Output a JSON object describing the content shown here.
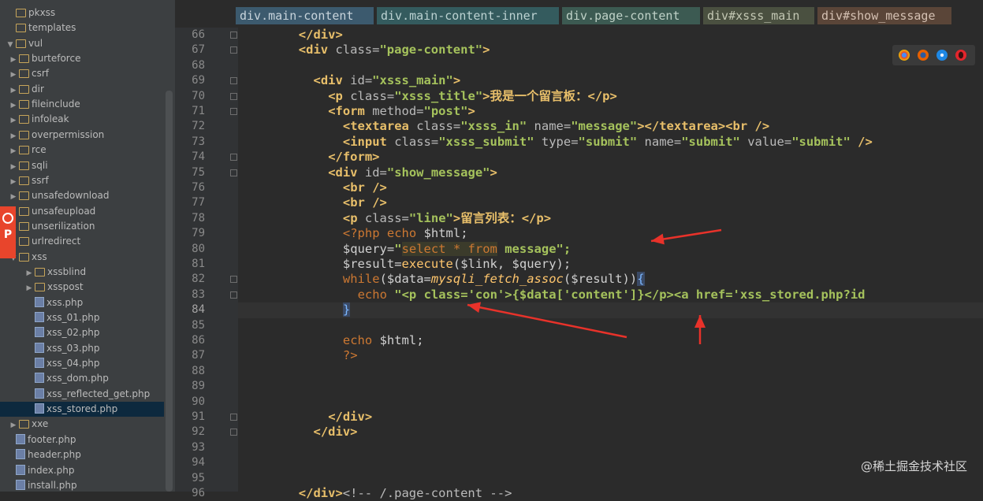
{
  "sidebar": {
    "items": [
      {
        "label": "pkxss",
        "kind": "folder",
        "indent": 0,
        "arrow": ""
      },
      {
        "label": "templates",
        "kind": "folder",
        "indent": 0,
        "arrow": ""
      },
      {
        "label": "vul",
        "kind": "folder",
        "indent": 0,
        "arrow": "▼"
      },
      {
        "label": "burteforce",
        "kind": "folder",
        "indent": 1,
        "arrow": "▶"
      },
      {
        "label": "csrf",
        "kind": "folder",
        "indent": 1,
        "arrow": "▶"
      },
      {
        "label": "dir",
        "kind": "folder",
        "indent": 1,
        "arrow": "▶"
      },
      {
        "label": "fileinclude",
        "kind": "folder",
        "indent": 1,
        "arrow": "▶"
      },
      {
        "label": "infoleak",
        "kind": "folder",
        "indent": 1,
        "arrow": "▶"
      },
      {
        "label": "overpermission",
        "kind": "folder",
        "indent": 1,
        "arrow": "▶"
      },
      {
        "label": "rce",
        "kind": "folder",
        "indent": 1,
        "arrow": "▶"
      },
      {
        "label": "sqli",
        "kind": "folder",
        "indent": 1,
        "arrow": "▶"
      },
      {
        "label": "ssrf",
        "kind": "folder",
        "indent": 1,
        "arrow": "▶"
      },
      {
        "label": "unsafedownload",
        "kind": "folder",
        "indent": 1,
        "arrow": "▶"
      },
      {
        "label": "unsafeupload",
        "kind": "folder",
        "indent": 1,
        "arrow": "▶"
      },
      {
        "label": "unserilization",
        "kind": "folder",
        "indent": 1,
        "arrow": "▶"
      },
      {
        "label": "urlredirect",
        "kind": "folder",
        "indent": 1,
        "arrow": "▶"
      },
      {
        "label": "xss",
        "kind": "folder",
        "indent": 1,
        "arrow": "▼"
      },
      {
        "label": "xssblind",
        "kind": "folder",
        "indent": 2,
        "arrow": "▶"
      },
      {
        "label": "xsspost",
        "kind": "folder",
        "indent": 2,
        "arrow": "▶"
      },
      {
        "label": "xss.php",
        "kind": "file",
        "indent": 2,
        "arrow": ""
      },
      {
        "label": "xss_01.php",
        "kind": "file",
        "indent": 2,
        "arrow": ""
      },
      {
        "label": "xss_02.php",
        "kind": "file",
        "indent": 2,
        "arrow": ""
      },
      {
        "label": "xss_03.php",
        "kind": "file",
        "indent": 2,
        "arrow": ""
      },
      {
        "label": "xss_04.php",
        "kind": "file",
        "indent": 2,
        "arrow": ""
      },
      {
        "label": "xss_dom.php",
        "kind": "file",
        "indent": 2,
        "arrow": ""
      },
      {
        "label": "xss_reflected_get.php",
        "kind": "file",
        "indent": 2,
        "arrow": ""
      },
      {
        "label": "xss_stored.php",
        "kind": "file",
        "indent": 2,
        "arrow": "",
        "selected": true
      },
      {
        "label": "xxe",
        "kind": "folder",
        "indent": 1,
        "arrow": "▶"
      },
      {
        "label": "footer.php",
        "kind": "file",
        "indent": 0,
        "arrow": ""
      },
      {
        "label": "header.php",
        "kind": "file",
        "indent": 0,
        "arrow": ""
      },
      {
        "label": "index.php",
        "kind": "file",
        "indent": 0,
        "arrow": ""
      },
      {
        "label": "install.php",
        "kind": "file",
        "indent": 0,
        "arrow": ""
      }
    ],
    "badge_letter": "P"
  },
  "breadcrumb": [
    {
      "label": "div.main-content",
      "bg": "#3c5a6e",
      "fg": "#c8d4dc"
    },
    {
      "label": "div.main-content-inner",
      "bg": "#345b5e",
      "fg": "#bcd2d2"
    },
    {
      "label": "div.page-content",
      "bg": "#3c5a52",
      "fg": "#c0d2c8"
    },
    {
      "label": "div#xsss_main",
      "bg": "#4a5040",
      "fg": "#c4c8b4"
    },
    {
      "label": "div#show_message",
      "bg": "#5a4538",
      "fg": "#d4c0b2"
    }
  ],
  "editor": {
    "line_numbers": [
      "66",
      "67",
      "68",
      "69",
      "70",
      "71",
      "72",
      "73",
      "74",
      "75",
      "76",
      "77",
      "78",
      "79",
      "80",
      "81",
      "82",
      "83",
      "84",
      "85",
      "86",
      "87",
      "88",
      "89",
      "90",
      "91",
      "92",
      "93",
      "94",
      "95",
      "96"
    ],
    "current_line": "84",
    "code": {
      "l66": "</div>",
      "l67_open": "<div ",
      "l67_attr": "class=",
      "l67_val": "\"page-content\"",
      "l67_close": ">",
      "l69_open": "<div ",
      "l69_attr": "id=",
      "l69_val": "\"xsss_main\"",
      "l69_close": ">",
      "l70_open": "<p ",
      "l70_attr": "class=",
      "l70_val": "\"xsss_title\"",
      "l70_text": ">我是一个留言板：</p>",
      "l71_open": "<form ",
      "l71_attr": "method=",
      "l71_val": "\"post\"",
      "l71_close": ">",
      "l72_open": "<textarea ",
      "l72_attr1": "class=",
      "l72_val1": "\"xsss_in\"",
      "l72_attr2": " name=",
      "l72_val2": "\"message\"",
      "l72_close": "></textarea><br />",
      "l73_open": "<input ",
      "l73_attr1": "class=",
      "l73_val1": "\"xsss_submit\"",
      "l73_attr2": " type=",
      "l73_val2": "\"submit\"",
      "l73_attr3": " name=",
      "l73_val3": "\"submit\"",
      "l73_attr4": " value=",
      "l73_val4": "\"submit\"",
      "l73_close": " />",
      "l74": "</form>",
      "l75_open": "<div ",
      "l75_attr": "id=",
      "l75_val": "\"show_message\"",
      "l75_close": ">",
      "l76": "<br />",
      "l77": "<br />",
      "l78_open": "<p ",
      "l78_attr": "class=",
      "l78_val": "\"line\"",
      "l78_text": ">留言列表：</p>",
      "l79_tag": "<?php ",
      "l79_kw": "echo ",
      "l79_var": "$html;",
      "l80_var": "$query=",
      "l80_q1": "\"",
      "l80_sql": "select * from",
      "l80_rest": " message\";",
      "l81_var": "$result=",
      "l81_fn": "execute",
      "l81_rest": "($link, $query);",
      "l82_kw": "while",
      "l82_a": "($data=",
      "l82_fn": "mysqli_fetch_assoc",
      "l82_b": "($result))",
      "l82_brace": "{",
      "l83_kw": "echo ",
      "l83_s1": "\"<p class='con",
      "l83_mid": "'>{$data['content']}</p><a href='xss_stored.php?id",
      "l84_brace": "}",
      "l86_kw": "echo ",
      "l86_var": "$html;",
      "l87": "?>",
      "l91": "</div>",
      "l92": "</div>",
      "l96_tag": "</div>",
      "l96_comment": "<!-- /.page-content -->"
    }
  },
  "browser_icons": [
    "chrome-icon",
    "firefox-icon",
    "safari-icon",
    "opera-icon"
  ],
  "annotation_color": "#e8322a",
  "watermark": "@稀土掘金技术社区"
}
